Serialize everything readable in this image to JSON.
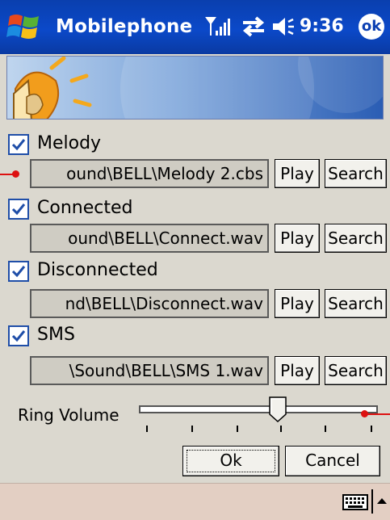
{
  "titlebar": {
    "title": "Mobilephone",
    "time": "9:36",
    "ok_label": "ok"
  },
  "sounds": [
    {
      "label": "Melody",
      "checked": true,
      "path": "ound\\BELL\\Melody 2.cbs",
      "play": "Play",
      "search": "Search"
    },
    {
      "label": "Connected",
      "checked": true,
      "path": "ound\\BELL\\Connect.wav",
      "play": "Play",
      "search": "Search"
    },
    {
      "label": "Disconnected",
      "checked": true,
      "path": "nd\\BELL\\Disconnect.wav",
      "play": "Play",
      "search": "Search"
    },
    {
      "label": "SMS",
      "checked": true,
      "path": "\\Sound\\BELL\\SMS 1.wav",
      "play": "Play",
      "search": "Search"
    }
  ],
  "volume": {
    "label": "Ring Volume",
    "level": 0.58
  },
  "dialog": {
    "ok": "Ok",
    "cancel": "Cancel"
  },
  "colors": {
    "titlebar": "#0b49c9",
    "checkbox_border": "#1f4ea8",
    "bottombar": "#e3cfc3",
    "annotation": "#dd1111"
  },
  "icons": [
    "windows-start-icon",
    "signal-icon",
    "sync-icon",
    "volume-icon",
    "speaker-graphic",
    "keyboard-icon",
    "up-arrow-icon"
  ]
}
